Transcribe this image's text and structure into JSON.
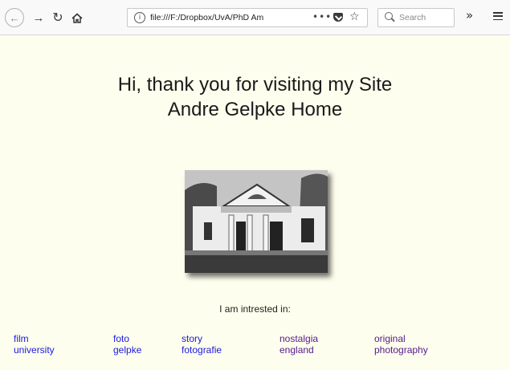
{
  "browser": {
    "url": "file:///F:/Dropbox/UvA/PhD Am",
    "page_actions_label": "•••",
    "search_placeholder": "Search",
    "overflow_label": "»"
  },
  "page": {
    "heading_line1": "Hi, thank you for visiting my Site",
    "heading_line2": "Andre Gelpke Home",
    "interest_label": "I am intrested in:",
    "keyword_columns": [
      {
        "top": "film",
        "bottom": "university",
        "color": "blue"
      },
      {
        "top": "foto",
        "bottom": "gelpke",
        "color": "blue"
      },
      {
        "top": "story",
        "bottom": "fotografie",
        "color": "blue"
      },
      {
        "top": "nostalgia",
        "bottom": "england",
        "color": "purple"
      },
      {
        "top": "original",
        "bottom": "photography",
        "color": "purple"
      }
    ]
  },
  "colors": {
    "page_background": "#fefeee",
    "link_blue": "#1a1ae0",
    "link_visited": "#551a8b"
  }
}
